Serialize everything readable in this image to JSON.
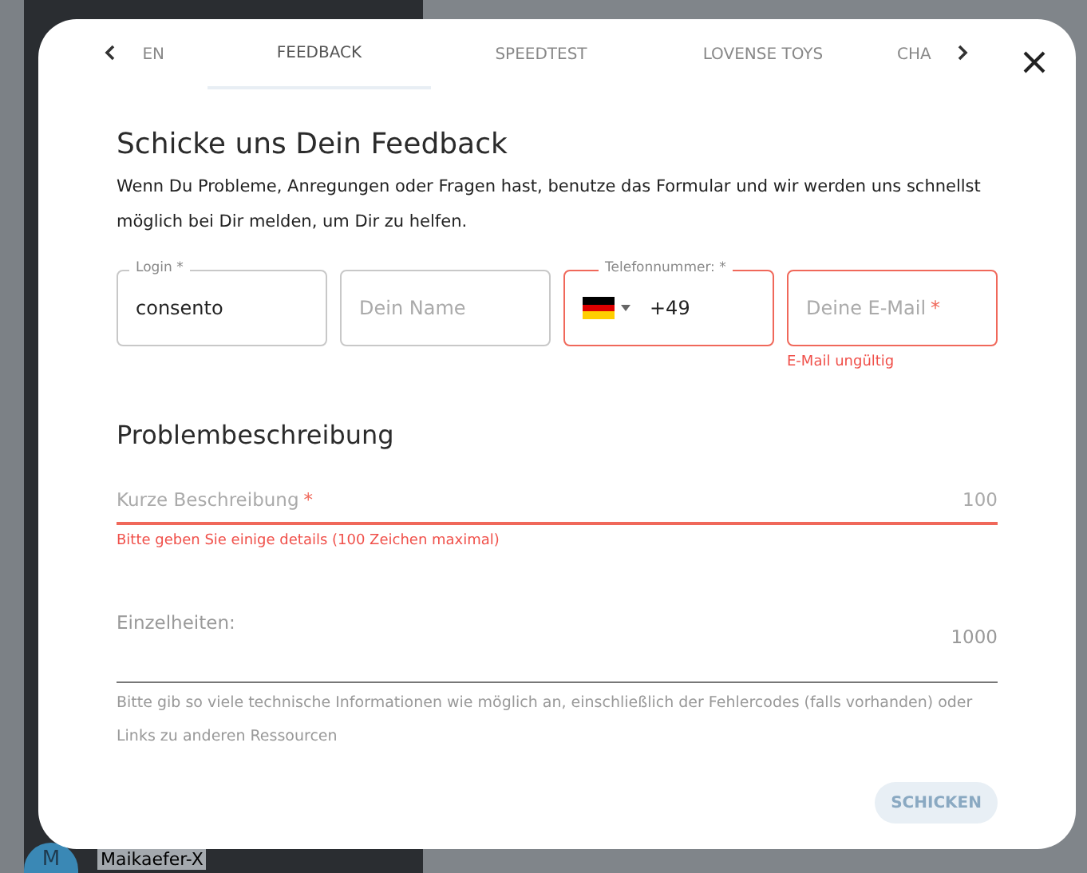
{
  "background": {
    "user_name": "Maikaefer-X",
    "avatar_letter": "M"
  },
  "tabs": [
    {
      "label": "EN",
      "selected": false
    },
    {
      "label": "FEEDBACK",
      "selected": true
    },
    {
      "label": "SPEEDTEST",
      "selected": false
    },
    {
      "label": "LOVENSE TOYS",
      "selected": false
    },
    {
      "label": "CHA",
      "selected": false
    }
  ],
  "title": "Schicke uns Dein Feedback",
  "intro": "Wenn Du Probleme, Anregungen oder Fragen hast, benutze das Formular und wir werden uns schnellst möglich bei Dir melden, um Dir zu helfen.",
  "fields": [
    {
      "kind": "text",
      "label": "Login *",
      "value": "consento",
      "invalid": false
    },
    {
      "kind": "text",
      "placeholder": "Dein Name",
      "invalid": false
    },
    {
      "kind": "phone",
      "label": "Telefonnummer: *",
      "value": "+49",
      "invalid": true
    },
    {
      "kind": "text",
      "placeholder": "Deine E-Mail",
      "required_mark": "*",
      "invalid": true,
      "error": "E-Mail ungültig"
    }
  ],
  "section_title": "Problembeschreibung",
  "short_description": {
    "placeholder": "Kurze Beschreibung",
    "required_mark": "*",
    "counter": "100",
    "invalid": true,
    "error": "Bitte geben Sie einige details (100 Zeichen maximal)"
  },
  "details": {
    "placeholder": "Einzelheiten:",
    "counter": "1000",
    "invalid": false,
    "hint": "Bitte gib so viele technische Informationen wie möglich an, einschließlich der Fehlercodes (falls vorhanden) oder Links zu anderen Ressourcen"
  },
  "submit": {
    "label": "SCHICKEN",
    "disabled": true
  }
}
